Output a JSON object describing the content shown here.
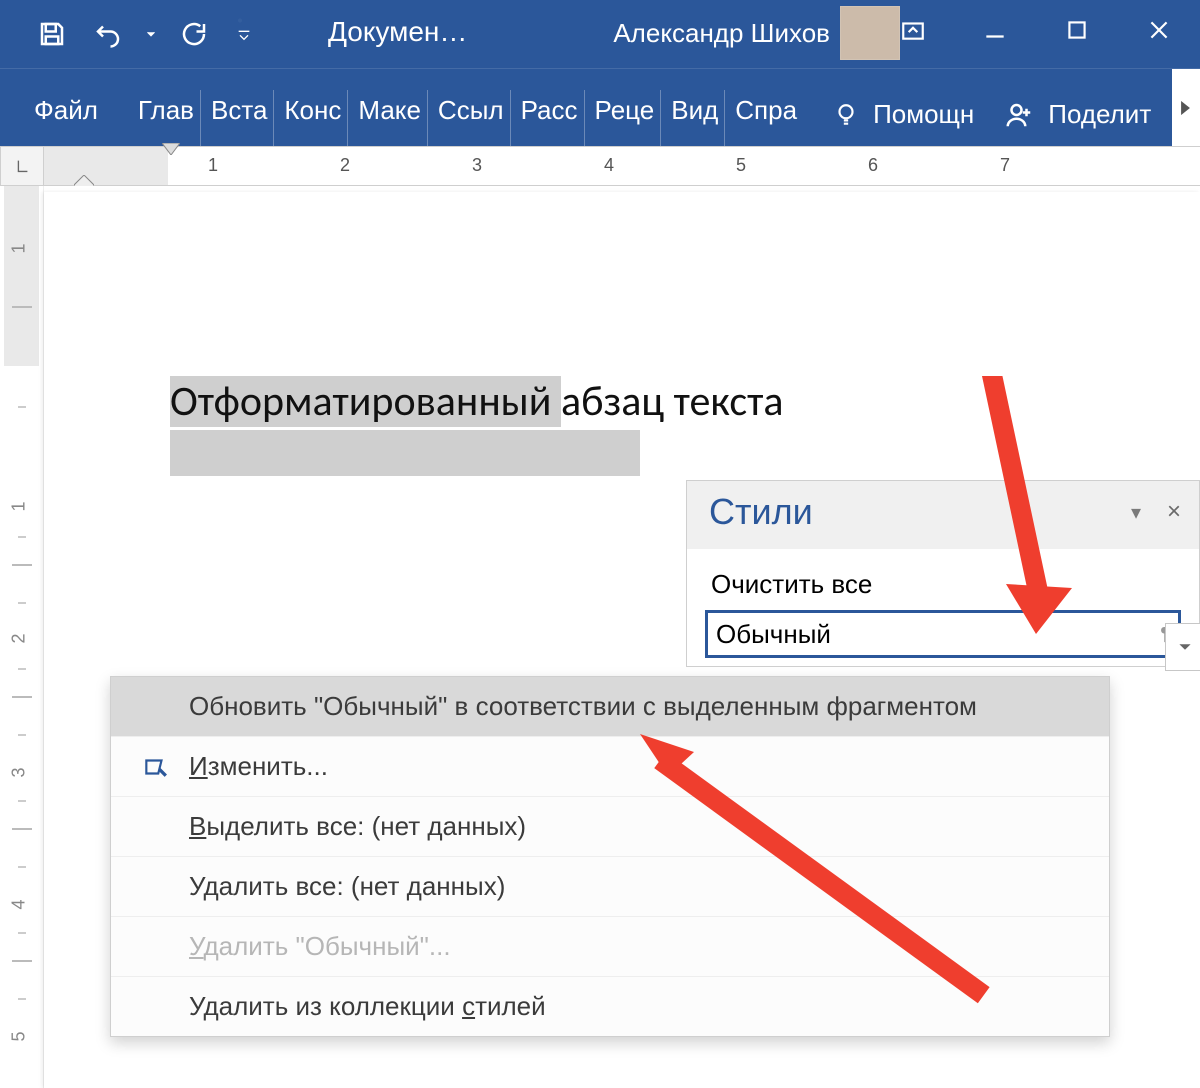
{
  "title": "Докумен…",
  "user": "Александр Шихов",
  "ribbon_tabs": [
    "Файл",
    "Глав",
    "Вста",
    "Конс",
    "Маке",
    "Ссыл",
    "Расс",
    "Реце",
    "Вид",
    "Спра"
  ],
  "help_label": "Помощн",
  "share_label": "Поделит",
  "ruler_numbers": [
    "1",
    "2",
    "3",
    "4",
    "5",
    "6",
    "7"
  ],
  "vruler": [
    "1",
    "1",
    "2",
    "3",
    "4",
    "5"
  ],
  "doc_line": {
    "selected": "Отформатированный ",
    "rest": "абзац текста"
  },
  "styles_pane": {
    "title": "Стили",
    "clear": "Очистить все",
    "current": "Обычный"
  },
  "ctx_menu": {
    "items": [
      {
        "key": "update",
        "label": "Обновить \"Обычный\" в соответствии с выделенным фрагментом",
        "hi": true
      },
      {
        "key": "modify",
        "label": "Изменить...",
        "icon": true,
        "ul": "И"
      },
      {
        "key": "selectall",
        "label": "Выделить все: (нет данных)",
        "ul": "В"
      },
      {
        "key": "removeall",
        "label": "Удалить все: (нет данных)"
      },
      {
        "key": "delete",
        "label": "Удалить \"Обычный\"...",
        "disabled": true,
        "ul": "У"
      },
      {
        "key": "removegal",
        "label": "Удалить из коллекции стилей",
        "ul2": "с"
      }
    ]
  }
}
